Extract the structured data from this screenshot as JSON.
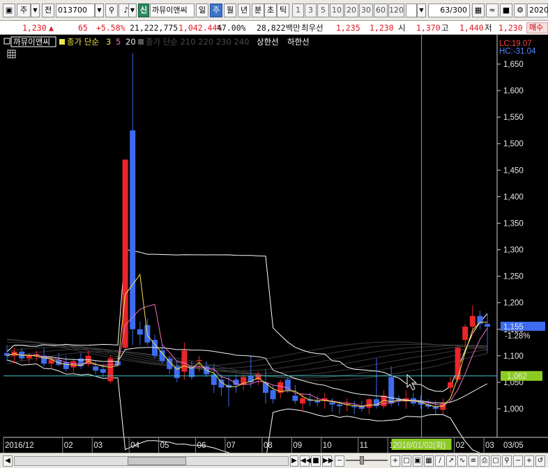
{
  "toolbar": {
    "market": "주",
    "prev": "전",
    "code": "013700",
    "badge": "신",
    "name": "까뮤이앤씨",
    "periods": [
      "일",
      "주",
      "월",
      "년",
      "분",
      "초",
      "틱"
    ],
    "active_period": "주",
    "minutes": [
      "1",
      "3",
      "5",
      "10",
      "20",
      "30",
      "60",
      "120"
    ],
    "count": "63",
    "count_max": "/300",
    "date": "2020."
  },
  "quote": {
    "price": "1,230",
    "arrow": "▲",
    "change": "65",
    "pct": "+5.58%",
    "volume": "21,222,775",
    "vol_ratio": "1,042.44%",
    "turnover": "47.00%",
    "amount": "28,822백만",
    "best_label": "최우선",
    "best_ask": "1,235",
    "best_bid": "1,230",
    "open_label": "시",
    "open": "1,370",
    "high_label": "고",
    "high": "1,440",
    "low_label": "저",
    "low": "1,230",
    "trade_tag": "매수"
  },
  "legend": {
    "name": "까뮤이앤씨",
    "ma_label": "종가 단순",
    "ma_periods": [
      "3",
      "5",
      "20"
    ],
    "ma_faded": "종가 단순 210  220  230  240",
    "upper": "상한선",
    "lower": "하한선"
  },
  "info": {
    "lc": "LC:19.07",
    "hc": "HC:-31.04"
  },
  "crosshair": {
    "date": "2018/01/02(화)",
    "price": "1,062"
  },
  "colors": {
    "up": "#e8262a",
    "down": "#3e6cf0",
    "bg": "#000000",
    "ma3": "#f0e64a",
    "ma5": "#f070c0",
    "ma20": "#f0f0f0",
    "band": "#ffffff",
    "crosshair": "#39c6c6",
    "lastPrice": "#3e6cf0",
    "crossPrice": "#8ccc22"
  },
  "chart_data": {
    "type": "candlestick",
    "interval": "weekly",
    "ylim": [
      960,
      1680
    ],
    "yticks": [
      1000,
      1050,
      1100,
      1150,
      1200,
      1250,
      1300,
      1350,
      1400,
      1450,
      1500,
      1550,
      1600,
      1650
    ],
    "ytick_labels": [
      "1,000",
      "1,050",
      "1,100",
      "1,150",
      "1,200",
      "1,250",
      "1,300",
      "1,350",
      "1,400",
      "1,450",
      "1,500",
      "1,550",
      "1,600",
      "1,650"
    ],
    "x_labels": [
      {
        "label": "2016/12",
        "index": 0
      },
      {
        "label": "02",
        "index": 8
      },
      {
        "label": "03",
        "index": 12
      },
      {
        "label": "04",
        "index": 17
      },
      {
        "label": "05",
        "index": 21
      },
      {
        "label": "06",
        "index": 26
      },
      {
        "label": "07",
        "index": 30
      },
      {
        "label": "08",
        "index": 35
      },
      {
        "label": "09",
        "index": 39
      },
      {
        "label": "10",
        "index": 43
      },
      {
        "label": "11",
        "index": 48
      },
      {
        "label": "12",
        "index": 52
      },
      {
        "label": "02",
        "index": 61
      },
      {
        "label": "03",
        "index": 65
      }
    ],
    "x_last_label": "03/05",
    "last_price": 1155,
    "last_change": "-1.28%",
    "crosshair_price": 1062,
    "crosshair_index": 56,
    "candles": [
      {
        "o": 1105,
        "h": 1120,
        "l": 1090,
        "c": 1100
      },
      {
        "o": 1100,
        "h": 1115,
        "l": 1085,
        "c": 1108
      },
      {
        "o": 1108,
        "h": 1115,
        "l": 1090,
        "c": 1095
      },
      {
        "o": 1095,
        "h": 1105,
        "l": 1085,
        "c": 1100
      },
      {
        "o": 1100,
        "h": 1110,
        "l": 1090,
        "c": 1103
      },
      {
        "o": 1100,
        "h": 1115,
        "l": 1080,
        "c": 1085
      },
      {
        "o": 1085,
        "h": 1100,
        "l": 1075,
        "c": 1092
      },
      {
        "o": 1092,
        "h": 1105,
        "l": 1080,
        "c": 1083
      },
      {
        "o": 1088,
        "h": 1100,
        "l": 1070,
        "c": 1075
      },
      {
        "o": 1078,
        "h": 1095,
        "l": 1065,
        "c": 1090
      },
      {
        "o": 1095,
        "h": 1105,
        "l": 1075,
        "c": 1080
      },
      {
        "o": 1085,
        "h": 1110,
        "l": 1080,
        "c": 1100
      },
      {
        "o": 1080,
        "h": 1090,
        "l": 1065,
        "c": 1072
      },
      {
        "o": 1075,
        "h": 1085,
        "l": 1060,
        "c": 1068
      },
      {
        "o": 1052,
        "h": 1100,
        "l": 1048,
        "c": 1095
      },
      {
        "o": 1090,
        "h": 1100,
        "l": 1080,
        "c": 1082
      },
      {
        "o": 1115,
        "h": 1470,
        "l": 1110,
        "c": 1470
      },
      {
        "o": 1525,
        "h": 1670,
        "l": 1120,
        "c": 1150
      },
      {
        "o": 1150,
        "h": 1165,
        "l": 1120,
        "c": 1140
      },
      {
        "o": 1158,
        "h": 1170,
        "l": 1120,
        "c": 1125
      },
      {
        "o": 1130,
        "h": 1140,
        "l": 1095,
        "c": 1100
      },
      {
        "o": 1110,
        "h": 1120,
        "l": 1085,
        "c": 1090
      },
      {
        "o": 1095,
        "h": 1100,
        "l": 1065,
        "c": 1075
      },
      {
        "o": 1080,
        "h": 1090,
        "l": 1050,
        "c": 1058
      },
      {
        "o": 1070,
        "h": 1125,
        "l": 1055,
        "c": 1110
      },
      {
        "o": 1080,
        "h": 1090,
        "l": 1055,
        "c": 1060
      },
      {
        "o": 1090,
        "h": 1100,
        "l": 1070,
        "c": 1092
      },
      {
        "o": 1080,
        "h": 1090,
        "l": 1060,
        "c": 1065
      },
      {
        "o": 1065,
        "h": 1085,
        "l": 1030,
        "c": 1045
      },
      {
        "o": 1055,
        "h": 1065,
        "l": 1025,
        "c": 1040
      },
      {
        "o": 1045,
        "h": 1060,
        "l": 1005,
        "c": 1040
      },
      {
        "o": 1055,
        "h": 1065,
        "l": 1030,
        "c": 1045
      },
      {
        "o": 1045,
        "h": 1065,
        "l": 1035,
        "c": 1060
      },
      {
        "o": 1062,
        "h": 1100,
        "l": 1040,
        "c": 1050
      },
      {
        "o": 1055,
        "h": 1070,
        "l": 1045,
        "c": 1065
      },
      {
        "o": 1050,
        "h": 1075,
        "l": 1010,
        "c": 1030
      },
      {
        "o": 1035,
        "h": 1045,
        "l": 1010,
        "c": 1018
      },
      {
        "o": 1030,
        "h": 1055,
        "l": 1020,
        "c": 1050
      },
      {
        "o": 1055,
        "h": 1060,
        "l": 1030,
        "c": 1035
      },
      {
        "o": 1025,
        "h": 1045,
        "l": 1010,
        "c": 1015
      },
      {
        "o": 1010,
        "h": 1030,
        "l": 995,
        "c": 1020
      },
      {
        "o": 1018,
        "h": 1030,
        "l": 1005,
        "c": 1015
      },
      {
        "o": 1015,
        "h": 1025,
        "l": 1005,
        "c": 1012
      },
      {
        "o": 1015,
        "h": 1030,
        "l": 1000,
        "c": 1020
      },
      {
        "o": 1012,
        "h": 1020,
        "l": 995,
        "c": 1008
      },
      {
        "o": 1008,
        "h": 1015,
        "l": 990,
        "c": 1005
      },
      {
        "o": 1008,
        "h": 1020,
        "l": 995,
        "c": 1010
      },
      {
        "o": 1005,
        "h": 1015,
        "l": 990,
        "c": 1003
      },
      {
        "o": 1005,
        "h": 1015,
        "l": 995,
        "c": 1000
      },
      {
        "o": 1002,
        "h": 1020,
        "l": 990,
        "c": 1018
      },
      {
        "o": 1018,
        "h": 1095,
        "l": 1000,
        "c": 1005
      },
      {
        "o": 1005,
        "h": 1035,
        "l": 1000,
        "c": 1025
      },
      {
        "o": 1060,
        "h": 1080,
        "l": 1005,
        "c": 1010
      },
      {
        "o": 1018,
        "h": 1025,
        "l": 1005,
        "c": 1015
      },
      {
        "o": 1015,
        "h": 1035,
        "l": 1000,
        "c": 1020
      },
      {
        "o": 1020,
        "h": 1030,
        "l": 1005,
        "c": 1010
      },
      {
        "o": 1015,
        "h": 1025,
        "l": 1000,
        "c": 1008
      },
      {
        "o": 1008,
        "h": 1018,
        "l": 1000,
        "c": 1004
      },
      {
        "o": 1004,
        "h": 1015,
        "l": 990,
        "c": 1000
      },
      {
        "o": 998,
        "h": 1020,
        "l": 990,
        "c": 1010
      },
      {
        "o": 1040,
        "h": 1060,
        "l": 1030,
        "c": 1050
      },
      {
        "o": 1055,
        "h": 1120,
        "l": 1050,
        "c": 1115
      },
      {
        "o": 1130,
        "h": 1160,
        "l": 1115,
        "c": 1155
      },
      {
        "o": 1155,
        "h": 1195,
        "l": 1140,
        "c": 1175
      },
      {
        "o": 1175,
        "h": 1185,
        "l": 1150,
        "c": 1160
      },
      {
        "o": 1160,
        "h": 1180,
        "l": 1105,
        "c": 1155
      }
    ]
  }
}
